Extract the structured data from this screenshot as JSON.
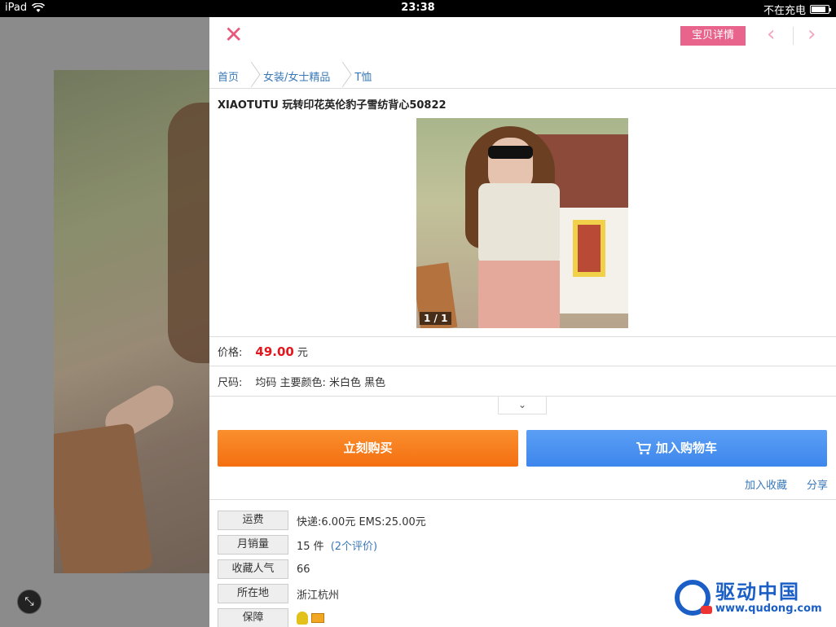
{
  "statusbar": {
    "device": "iPad",
    "time": "23:38",
    "charging": "不在充电",
    "battery_level": 0.85
  },
  "header": {
    "detail_button": "宝贝详情"
  },
  "breadcrumb": [
    "首页",
    "女装/女士精品",
    "T恤"
  ],
  "product": {
    "title": "XIAOTUTU 玩转印花英伦豹子雪纺背心50822",
    "image_counter": "1 / 1",
    "price_label": "价格:",
    "price_value": "49.00",
    "price_unit": "元",
    "size_label": "尺码:",
    "size_value": "均码 主要颜色: 米白色 黑色"
  },
  "actions": {
    "buy_now": "立刻购买",
    "add_to_cart": "加入购物车",
    "favorite": "加入收藏",
    "share": "分享"
  },
  "info": [
    {
      "label": "运费",
      "value": "快递:6.00元 EMS:25.00元",
      "link": ""
    },
    {
      "label": "月销量",
      "value": "15 件",
      "link": "(2个评价)"
    },
    {
      "label": "收藏人气",
      "value": "66",
      "link": ""
    },
    {
      "label": "所在地",
      "value": "浙江杭州",
      "link": ""
    },
    {
      "label": "保障",
      "value": "",
      "link": ""
    }
  ],
  "watermark": {
    "name": "驱动中国",
    "url": "www.qudong.com"
  },
  "colors": {
    "accent_pink": "#e8648c",
    "buy_orange": "#f47a1c",
    "cart_blue": "#4a92f0",
    "price_red": "#e3171e",
    "link_blue": "#3a78b8"
  }
}
